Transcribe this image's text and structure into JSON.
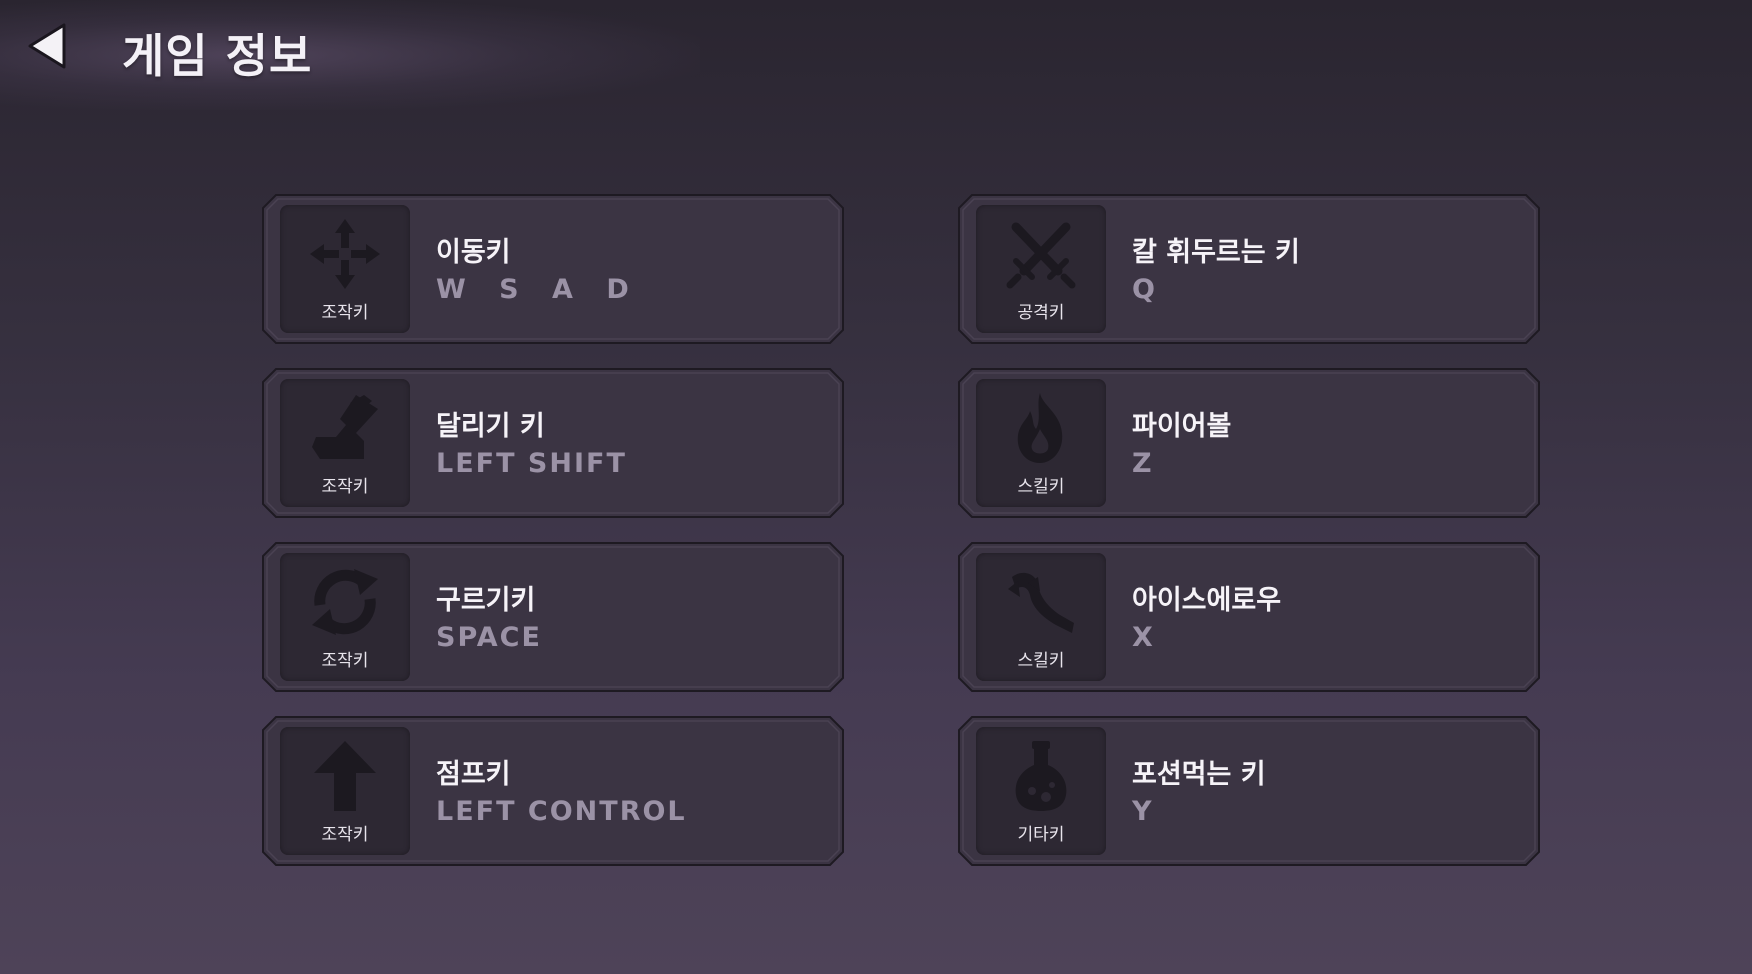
{
  "header": {
    "title": "게임 정보",
    "back_icon": "back-arrow-icon"
  },
  "colors": {
    "background_top": "#2a2530",
    "background_bottom": "#4e4358",
    "card_fill": "#3b3443",
    "card_border": "#1e1a22",
    "icon_box": "#2d2833",
    "icon_glyph": "#1c1920",
    "key_text": "#9b92a6"
  },
  "left_column": [
    {
      "title": "이동키",
      "key": "W S A D",
      "category": "조작키",
      "icon": "move-arrows-icon"
    },
    {
      "title": "달리기 키",
      "key": "LEFT SHIFT",
      "category": "조작키",
      "icon": "boot-icon"
    },
    {
      "title": "구르기키",
      "key": "SPACE",
      "category": "조작키",
      "icon": "roll-icon"
    },
    {
      "title": "점프키",
      "key": "LEFT CONTROL",
      "category": "조작키",
      "icon": "up-arrow-icon"
    }
  ],
  "right_column": [
    {
      "title": "칼 휘두르는 키",
      "key": "Q",
      "category": "공격키",
      "icon": "crossed-swords-icon"
    },
    {
      "title": "파이어볼",
      "key": "Z",
      "category": "스킬키",
      "icon": "flame-icon"
    },
    {
      "title": "아이스에로우",
      "key": "X",
      "category": "스킬키",
      "icon": "ice-arrow-icon"
    },
    {
      "title": "포션먹는 키",
      "key": "Y",
      "category": "기타키",
      "icon": "potion-icon"
    }
  ]
}
